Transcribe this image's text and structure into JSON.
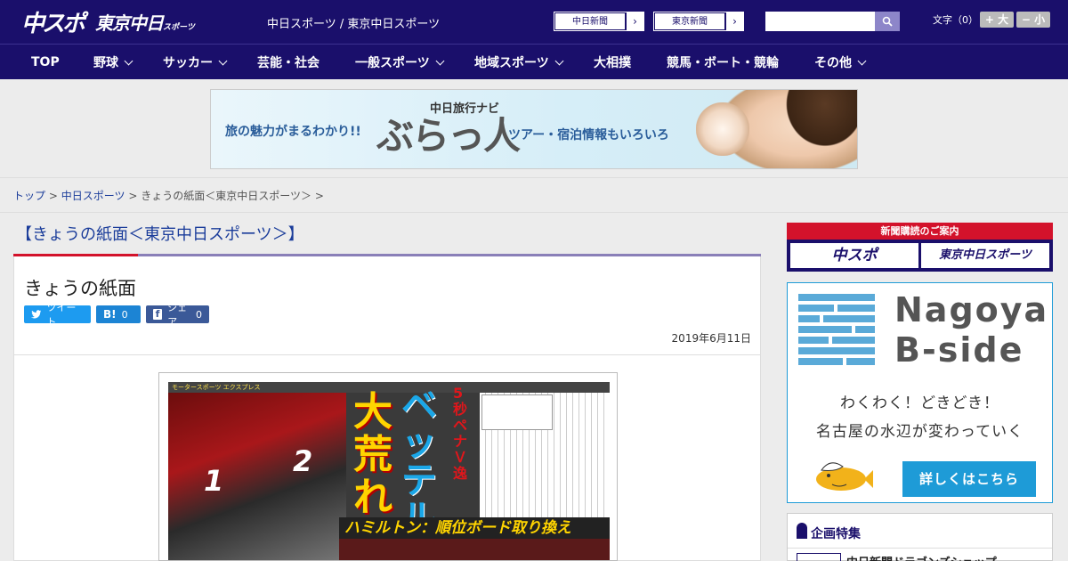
{
  "header": {
    "logo_main": "中スポ",
    "logo_sub": "東京中日",
    "logo_sub_small": "スポーツ",
    "site_link": "中日スポーツ / 東京中日スポーツ",
    "ext_links": [
      {
        "label": "中日新聞"
      },
      {
        "label": "東京新聞"
      }
    ],
    "search_placeholder": "",
    "fontsize_label": "文字（0）",
    "fontsize_plus": "+ 大",
    "fontsize_minus": "− 小"
  },
  "nav": {
    "items": [
      {
        "label": "TOP",
        "has_menu": false
      },
      {
        "label": "野球",
        "has_menu": true
      },
      {
        "label": "サッカー",
        "has_menu": true
      },
      {
        "label": "芸能・社会",
        "has_menu": false
      },
      {
        "label": "一般スポーツ",
        "has_menu": true
      },
      {
        "label": "地域スポーツ",
        "has_menu": true
      },
      {
        "label": "大相撲",
        "has_menu": false
      },
      {
        "label": "競馬・ボート・競輪",
        "has_menu": false
      },
      {
        "label": "その他",
        "has_menu": true
      }
    ]
  },
  "banner": {
    "left_text": "旅の魅力がまるわかり!!",
    "small_title": "中日旅行ナビ",
    "big_title": "ぶらっ人",
    "right_text": "ツアー・宿泊情報もいろいろ"
  },
  "breadcrumb": {
    "items": [
      "トップ",
      "中日スポーツ"
    ],
    "current": "きょうの紙面＜東京中日スポーツ＞",
    "separator": ">"
  },
  "main": {
    "section_title": "【きょうの紙面＜東京中日スポーツ＞】",
    "article_title": "きょうの紙面",
    "share": {
      "tweet": "ツイート",
      "hatena_glyph": "B!",
      "hatena_count": "0",
      "fb_glyph": "f",
      "fb_label": "シェア",
      "fb_count": "0"
    },
    "date": "2019年6月11日",
    "paper": {
      "header_text": "モータースポーツ エクスプレス",
      "num1": "1",
      "num2": "2",
      "headline_yellow": "大荒れ",
      "headline_blue": "ベッテル",
      "sub_red": "5秒ペナＶ逸",
      "bottom_line": "ハミルトン：順位ボード取り換え"
    }
  },
  "sidebar": {
    "subscribe_head": "新聞購読のご案内",
    "subscribe_btn1": "中スポ",
    "subscribe_btn2": "東京中日スポーツ",
    "bside_title_line1": "Nagoya",
    "bside_title_line2": "B-side",
    "bside_tag1": "わくわく！どきどき！",
    "bside_tag2": "名古屋の水辺が変わっていく",
    "bside_button": "詳しくはこちら",
    "feature_title": "企画特集",
    "feature_item": "中日新聞ドラゴンズショップ"
  },
  "colors": {
    "navy": "#1a0f6b",
    "red": "#d3122b",
    "blue_link": "#1a3c9a",
    "bside_blue": "#1e9bd7"
  }
}
